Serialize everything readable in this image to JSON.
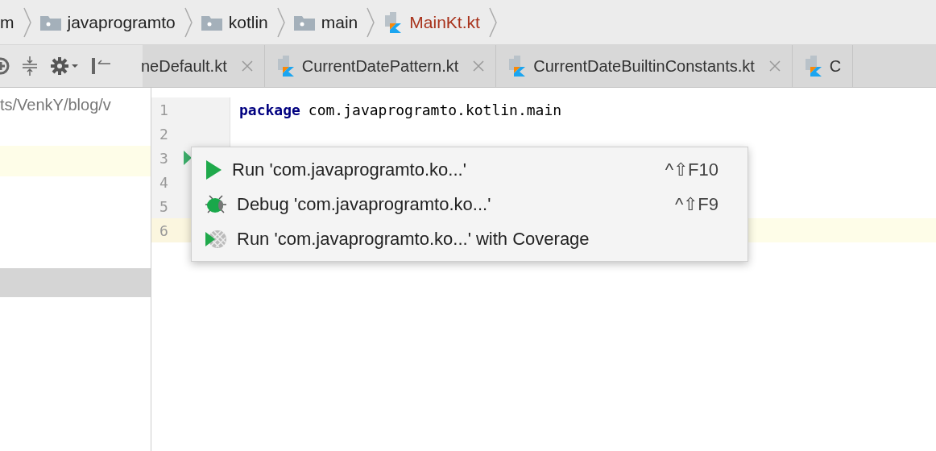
{
  "breadcrumbs": [
    {
      "label": "m",
      "kind": "none"
    },
    {
      "label": "javaprogramto",
      "kind": "folder"
    },
    {
      "label": "kotlin",
      "kind": "folder"
    },
    {
      "label": "main",
      "kind": "folder"
    },
    {
      "label": "MainKt.kt",
      "kind": "file"
    }
  ],
  "project_panel": {
    "path": "ts/VenkY/blog/v"
  },
  "tabs": [
    {
      "label": "neDefault.kt",
      "icon": false
    },
    {
      "label": "CurrentDatePattern.kt",
      "icon": true
    },
    {
      "label": "CurrentDateBuiltinConstants.kt",
      "icon": true
    },
    {
      "label": "C",
      "icon": true
    }
  ],
  "editor": {
    "lines": [
      {
        "number": "1",
        "keyword": "package",
        "text": "com.javaprogramto.kotlin.main",
        "current": false
      },
      {
        "number": "2",
        "current": false
      },
      {
        "number": "3",
        "current": false,
        "run_marker": true
      },
      {
        "number": "4",
        "current": false
      },
      {
        "number": "5",
        "current": false
      },
      {
        "number": "6",
        "current": true
      }
    ]
  },
  "context_menu": {
    "items": [
      {
        "kind": "run",
        "label": "Run 'com.javaprogramto.ko...'",
        "shortcut": "^⇧F10"
      },
      {
        "kind": "debug",
        "label": "Debug 'com.javaprogramto.ko...'",
        "shortcut": "^⇧F9"
      },
      {
        "kind": "coverage",
        "label": "Run 'com.javaprogramto.ko...' with Coverage"
      }
    ]
  }
}
